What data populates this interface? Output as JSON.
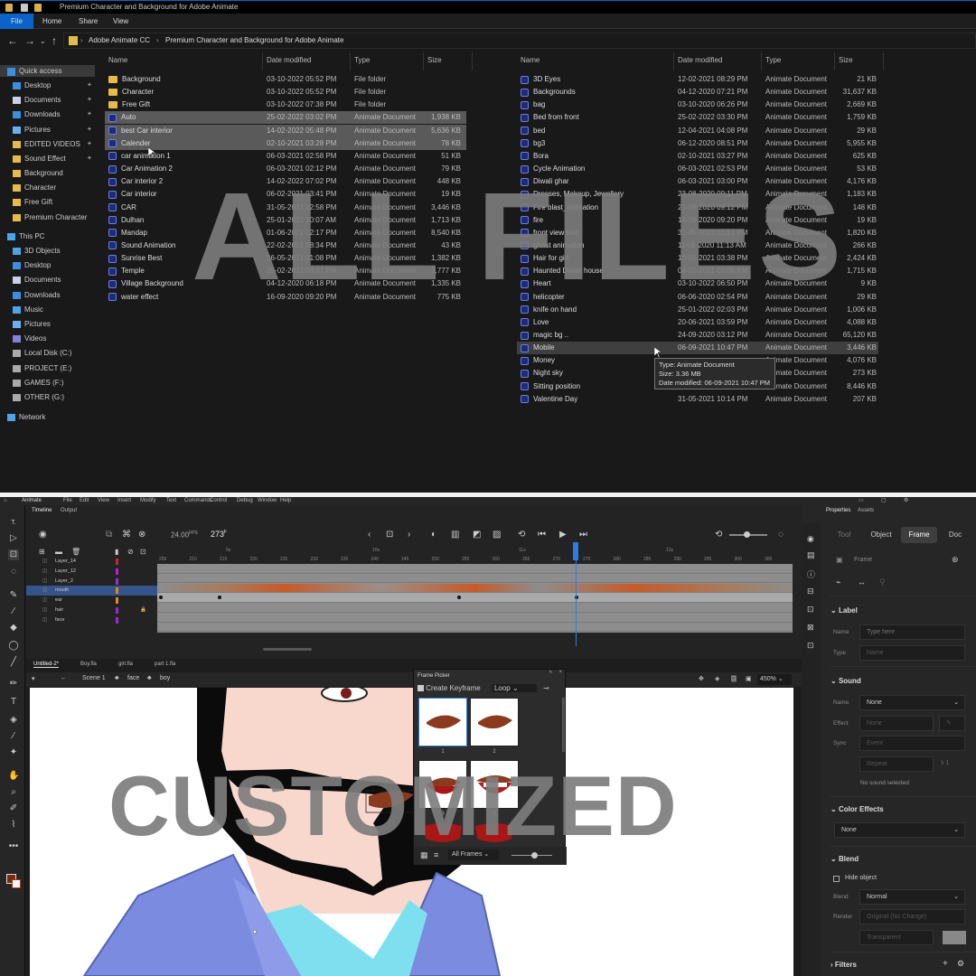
{
  "explorer": {
    "window_title": "Premium Character and Background for Adobe Animate",
    "ribbon_tabs": [
      "File",
      "Home",
      "Share",
      "View"
    ],
    "breadcrumb": [
      "Adobe Animate CC",
      "Premium Character and Background for Adobe Animate"
    ],
    "nav": {
      "quick_access": "Quick access",
      "pinned": [
        "Desktop",
        "Documents",
        "Downloads",
        "Pictures",
        "EDITED VIDEOS",
        "Sound Effect"
      ],
      "recent": [
        "Background",
        "Character",
        "Free Gift",
        "Premium Character"
      ],
      "this_pc": "This PC",
      "pc_items": [
        "3D Objects",
        "Desktop",
        "Documents",
        "Downloads",
        "Music",
        "Pictures",
        "Videos",
        "Local Disk (C:)",
        "PROJECT (E:)",
        "GAMES (F:)",
        "OTHER (G:)"
      ],
      "network": "Network"
    },
    "columns": {
      "name": "Name",
      "date": "Date modified",
      "type": "Type",
      "size": "Size"
    },
    "left_files": [
      {
        "name": "Background",
        "date": "03-10-2022 05:52 PM",
        "type": "File folder",
        "size": "",
        "kind": "folder"
      },
      {
        "name": "Character",
        "date": "03-10-2022 05:52 PM",
        "type": "File folder",
        "size": "",
        "kind": "folder"
      },
      {
        "name": "Free Gift",
        "date": "03-10-2022 07:38 PM",
        "type": "File folder",
        "size": "",
        "kind": "folder"
      },
      {
        "name": "Auto",
        "date": "25-02-2022 03:02 PM",
        "type": "Animate Document",
        "size": "1,938 KB",
        "kind": "an",
        "state": "selected"
      },
      {
        "name": "best Car interior",
        "date": "14-02-2022 05:48 PM",
        "type": "Animate Document",
        "size": "5,636 KB",
        "kind": "an",
        "state": "selected"
      },
      {
        "name": "Calender",
        "date": "02-10-2021 03:28 PM",
        "type": "Animate Document",
        "size": "78 KB",
        "kind": "an",
        "state": "selected"
      },
      {
        "name": "car animation 1",
        "date": "06-03-2021 02:58 PM",
        "type": "Animate Document",
        "size": "51 KB",
        "kind": "an"
      },
      {
        "name": "Car Animation 2",
        "date": "06-03-2021 02:12 PM",
        "type": "Animate Document",
        "size": "79 KB",
        "kind": "an"
      },
      {
        "name": "Car interior 2",
        "date": "14-02-2022 07:02 PM",
        "type": "Animate Document",
        "size": "448 KB",
        "kind": "an"
      },
      {
        "name": "Car interior",
        "date": "06-02-2021 03:41 PM",
        "type": "Animate Document",
        "size": "19 KB",
        "kind": "an"
      },
      {
        "name": "CAR",
        "date": "31-05-2023 02:58 PM",
        "type": "Animate Document",
        "size": "3,446 KB",
        "kind": "an"
      },
      {
        "name": "Dulhan",
        "date": "25-01-2022 10:07 AM",
        "type": "Animate Document",
        "size": "1,713 KB",
        "kind": "an"
      },
      {
        "name": "Mandap",
        "date": "01-06-2021 02:17 PM",
        "type": "Animate Document",
        "size": "8,540 KB",
        "kind": "an"
      },
      {
        "name": "Sound Animation",
        "date": "22-02-2022 08:34 PM",
        "type": "Animate Document",
        "size": "43 KB",
        "kind": "an"
      },
      {
        "name": "Sunrise Best",
        "date": "26-05-2021 01:08 PM",
        "type": "Animate Document",
        "size": "1,382 KB",
        "kind": "an"
      },
      {
        "name": "Temple",
        "date": "25-02-2022 03:07 PM",
        "type": "Animate Document",
        "size": "3,777 KB",
        "kind": "an"
      },
      {
        "name": "Village Background",
        "date": "04-12-2020 06:18 PM",
        "type": "Animate Document",
        "size": "1,335 KB",
        "kind": "an"
      },
      {
        "name": "water effect",
        "date": "16-09-2020 09:20 PM",
        "type": "Animate Document",
        "size": "775 KB",
        "kind": "an"
      }
    ],
    "right_files": [
      {
        "name": "3D Eyes",
        "date": "12-02-2021 08:29 PM",
        "type": "Animate Document",
        "size": "21 KB"
      },
      {
        "name": "Backgrounds",
        "date": "04-12-2020 07:21 PM",
        "type": "Animate Document",
        "size": "31,637 KB"
      },
      {
        "name": "bag",
        "date": "03-10-2020 06:26 PM",
        "type": "Animate Document",
        "size": "2,669 KB"
      },
      {
        "name": "Bed from front",
        "date": "25-02-2022 03:30 PM",
        "type": "Animate Document",
        "size": "1,759 KB"
      },
      {
        "name": "bed",
        "date": "12-04-2021 04:08 PM",
        "type": "Animate Document",
        "size": "29 KB"
      },
      {
        "name": "bg3",
        "date": "06-12-2020 08:51 PM",
        "type": "Animate Document",
        "size": "5,955 KB"
      },
      {
        "name": "Bora",
        "date": "02-10-2021 03:27 PM",
        "type": "Animate Document",
        "size": "625 KB"
      },
      {
        "name": "Cycle Animation",
        "date": "06-03-2021 02:53 PM",
        "type": "Animate Document",
        "size": "53 KB"
      },
      {
        "name": "Diwali ghar",
        "date": "06-03-2021 03:00 PM",
        "type": "Animate Document",
        "size": "4,176 KB"
      },
      {
        "name": "Dresses, Makeup, Jewellery",
        "date": "23-08-2020 09:11 PM",
        "type": "Animate Document",
        "size": "1,183 KB"
      },
      {
        "name": "Fire blast_animation",
        "date": "23-08-2020 09:12 PM",
        "type": "Animate Document",
        "size": "148 KB"
      },
      {
        "name": "fire",
        "date": "16-09-2020 09:20 PM",
        "type": "Animate Document",
        "size": "19 KB"
      },
      {
        "name": "front view bed",
        "date": "31-05-2021 03:51 PM",
        "type": "Animate Document",
        "size": "1,820 KB"
      },
      {
        "name": "ghost animation",
        "date": "11-06-2020 11:13 AM",
        "type": "Animate Document",
        "size": "266 KB"
      },
      {
        "name": "Hair for girl",
        "date": "13-03-2021 03:38 PM",
        "type": "Animate Document",
        "size": "2,424 KB"
      },
      {
        "name": "Haunted Diwali house",
        "date": "06-03-2021 03:05 PM",
        "type": "Animate Document",
        "size": "1,715 KB"
      },
      {
        "name": "Heart",
        "date": "03-10-2022 06:50 PM",
        "type": "Animate Document",
        "size": "9 KB"
      },
      {
        "name": "helicopter",
        "date": "06-06-2020 02:54 PM",
        "type": "Animate Document",
        "size": "29 KB"
      },
      {
        "name": "knife on hand",
        "date": "25-01-2022 02:03 PM",
        "type": "Animate Document",
        "size": "1,006 KB"
      },
      {
        "name": "Love",
        "date": "20-06-2021 03:59 PM",
        "type": "Animate Document",
        "size": "4,088 KB"
      },
      {
        "name": "magic bg ..",
        "date": "24-09-2020 03:12 PM",
        "type": "Animate Document",
        "size": "65,120 KB"
      },
      {
        "name": "Mobile",
        "date": "06-09-2021 10:47 PM",
        "type": "Animate Document",
        "size": "3,446 KB",
        "state": "hover"
      },
      {
        "name": "Money",
        "date": "",
        "type": "Animate Document",
        "size": "4,076 KB"
      },
      {
        "name": "Night sky",
        "date": "",
        "type": "Animate Document",
        "size": "273 KB"
      },
      {
        "name": "Sitting position",
        "date": "",
        "type": "Animate Document",
        "size": "8,446 KB"
      },
      {
        "name": "Valentine Day",
        "date": "31-05-2021 10:14 PM",
        "type": "Animate Document",
        "size": "207 KB"
      }
    ],
    "tooltip": [
      "Type: Animate Document",
      "Size: 3.36 MB",
      "Date modified: 06-09-2021 10:47 PM"
    ]
  },
  "watermark_top": "ALL FILES",
  "watermark_bottom": "CUSTOMIZED",
  "animate": {
    "app_name": "Animate",
    "menu": [
      "File",
      "Edit",
      "View",
      "Insert",
      "Modify",
      "Text",
      "Commands",
      "Control",
      "Debug",
      "Window",
      "Help"
    ],
    "timeline_tabs": [
      "Timeline",
      "Output"
    ],
    "fps": "24.00",
    "fps_unit": "FPS",
    "current_frame": "273",
    "frame_suffix": "F",
    "ruler_ticks": [
      "205",
      "210",
      "215",
      "220",
      "225",
      "230",
      "235",
      "240",
      "245",
      "250",
      "255",
      "260",
      "265",
      "270",
      "275",
      "280",
      "285",
      "290",
      "295",
      "300",
      "305"
    ],
    "ruler_seconds": [
      "9s",
      "10s",
      "11s",
      "12s"
    ],
    "layers": [
      "Layer_14",
      "Layer_12",
      "Layer_2",
      "mouth",
      "ear",
      "hair",
      "face"
    ],
    "layer_colors": [
      "#d0213c",
      "#c01dd4",
      "#9e2bd8",
      "#e0862a",
      "#e5892c",
      "#a424d4",
      "#a424d4"
    ],
    "selected_layer": "mouth",
    "doc_tabs": [
      "Untitled-2*",
      "Boy.fla",
      "girl.fla",
      "part 1.fla"
    ],
    "scene": [
      "Scene 1",
      "face",
      "boy"
    ],
    "zoom": "450%",
    "frame_picker": {
      "title": "Frame Picker",
      "create_keyframe": "Create Keyframe",
      "loop": "Loop",
      "thumb_labels": [
        "1",
        "2",
        "3",
        "4"
      ],
      "filter": "All Frames"
    },
    "properties": {
      "tabs": [
        "Properties",
        "Assets"
      ],
      "sub_tabs": [
        "Tool",
        "Object",
        "Frame",
        "Doc"
      ],
      "active_tab": "Frame",
      "frame_label": "Frame",
      "label_section": "Label",
      "name_label": "Name",
      "name_placeholder": "Type here",
      "type_label": "Type",
      "type_value": "Name",
      "sound_section": "Sound",
      "sound_name_label": "Name",
      "sound_name_value": "None",
      "effect_label": "Effect",
      "effect_value": "None",
      "sync_label": "Sync",
      "sync_value": "Event",
      "repeat_value": "Repeat",
      "repeat_count": "x 1",
      "no_sound": "No sound selected",
      "color_effects_section": "Color Effects",
      "color_effects_value": "None",
      "blend_section": "Blend",
      "hide_object": "Hide object",
      "blend_label": "Blend",
      "blend_value": "Normal",
      "render_label": "Render",
      "render_value": "Original (No Change)",
      "transparent_value": "Transparent",
      "filters_section": "Filters"
    }
  }
}
